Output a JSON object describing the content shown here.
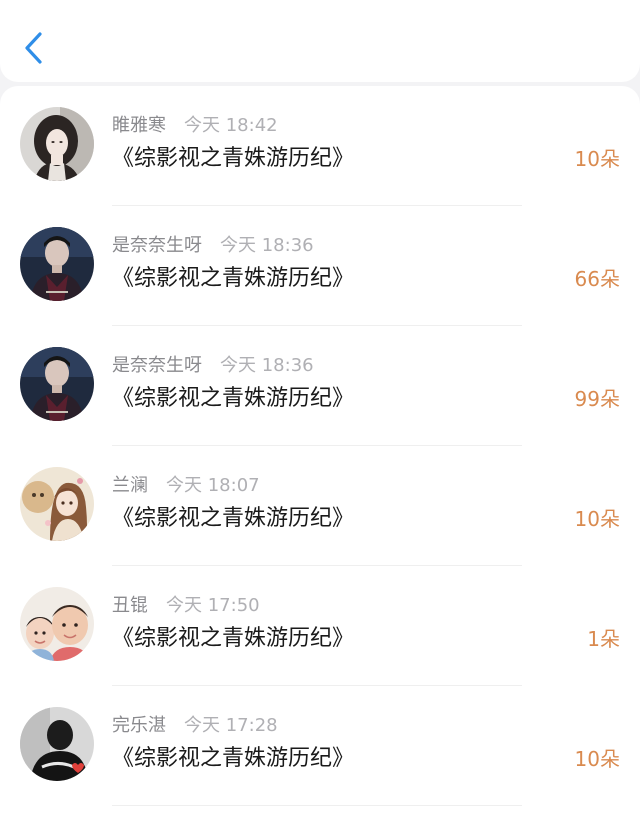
{
  "header": {
    "back_icon": "chevron-left-icon",
    "accent_color": "#2f8ee8"
  },
  "colors": {
    "name": "#8a8a8e",
    "time": "#b0b0b4",
    "title": "#1a1a1a",
    "amount": "#d98a4f"
  },
  "items": [
    {
      "name": "睢雅寒",
      "time": "今天 18:42",
      "title": "《综影视之青姝游历纪》",
      "amount": "10朵",
      "avatar": "girl-portrait-avatar"
    },
    {
      "name": "是奈奈生呀",
      "time": "今天 18:36",
      "title": "《综影视之青姝游历纪》",
      "amount": "66朵",
      "avatar": "man-in-costume-avatar"
    },
    {
      "name": "是奈奈生呀",
      "time": "今天 18:36",
      "title": "《综影视之青姝游历纪》",
      "amount": "99朵",
      "avatar": "man-in-costume-avatar"
    },
    {
      "name": "兰澜",
      "time": "今天 18:07",
      "title": "《综影视之青姝游历纪》",
      "amount": "10朵",
      "avatar": "anime-girl-with-lion-avatar"
    },
    {
      "name": "丑锟",
      "time": "今天 17:50",
      "title": "《综影视之青姝游历纪》",
      "amount": "1朵",
      "avatar": "two-children-avatar"
    },
    {
      "name": "完乐湛",
      "time": "今天 17:28",
      "title": "《综影视之青姝游历纪》",
      "amount": "10朵",
      "avatar": "dark-silhouette-avatar"
    }
  ]
}
